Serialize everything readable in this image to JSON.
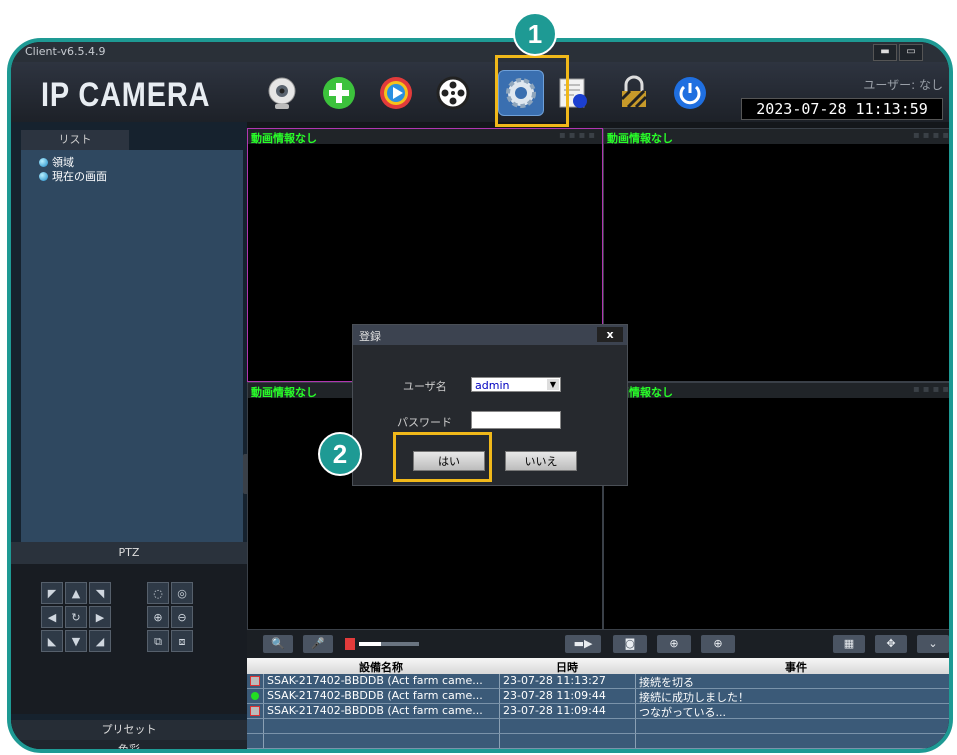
{
  "window": {
    "title": "Client-v6.5.4.9",
    "min_label": "▬",
    "max_label": "▭"
  },
  "header": {
    "logo": "IP CAMERA",
    "user_label": "ユーザー: なし",
    "datetime": "2023-07-28  11:13:59"
  },
  "toolbar": {
    "icons": [
      "webcam-icon",
      "add-icon",
      "media-player-icon",
      "film-reel-icon",
      "settings-gear-icon",
      "document-icon",
      "lock-icon",
      "power-icon"
    ]
  },
  "sidebar": {
    "tab_label": "リスト",
    "tree": [
      {
        "label": "領域"
      },
      {
        "label": "現在の画面"
      }
    ],
    "ptz_label": "PTZ",
    "preset_label": "プリセット",
    "color_label": "色彩"
  },
  "video": {
    "panes": [
      {
        "title": "動画情報なし"
      },
      {
        "title": "動画情報なし"
      },
      {
        "title": "動画情報なし"
      },
      {
        "title": "動画情報なし"
      }
    ]
  },
  "dialog": {
    "title": "登録",
    "close_label": "x",
    "username_label": "ユーザ名",
    "username_value": "admin",
    "password_label": "パスワード",
    "password_value": "",
    "yes_label": "はい",
    "no_label": "いいえ"
  },
  "annotations": {
    "step1": "1",
    "step2": "2",
    "highlight_color": "#f0b81a",
    "badge_color": "#1e9a94"
  },
  "events": {
    "columns": [
      "",
      "設備名称",
      "日時",
      "事件"
    ],
    "rows": [
      {
        "device": "SSAK-217402-BBDDB (Act farm came...",
        "time": "23-07-28 11:13:27",
        "event": "接続を切る",
        "status": "disconnected"
      },
      {
        "device": "SSAK-217402-BBDDB (Act farm came...",
        "time": "23-07-28 11:09:44",
        "event": "接続に成功しました！",
        "status": "connected"
      },
      {
        "device": "SSAK-217402-BBDDB (Act farm came...",
        "time": "23-07-28 11:09:44",
        "event": "つながっている...",
        "status": "connecting"
      }
    ]
  }
}
